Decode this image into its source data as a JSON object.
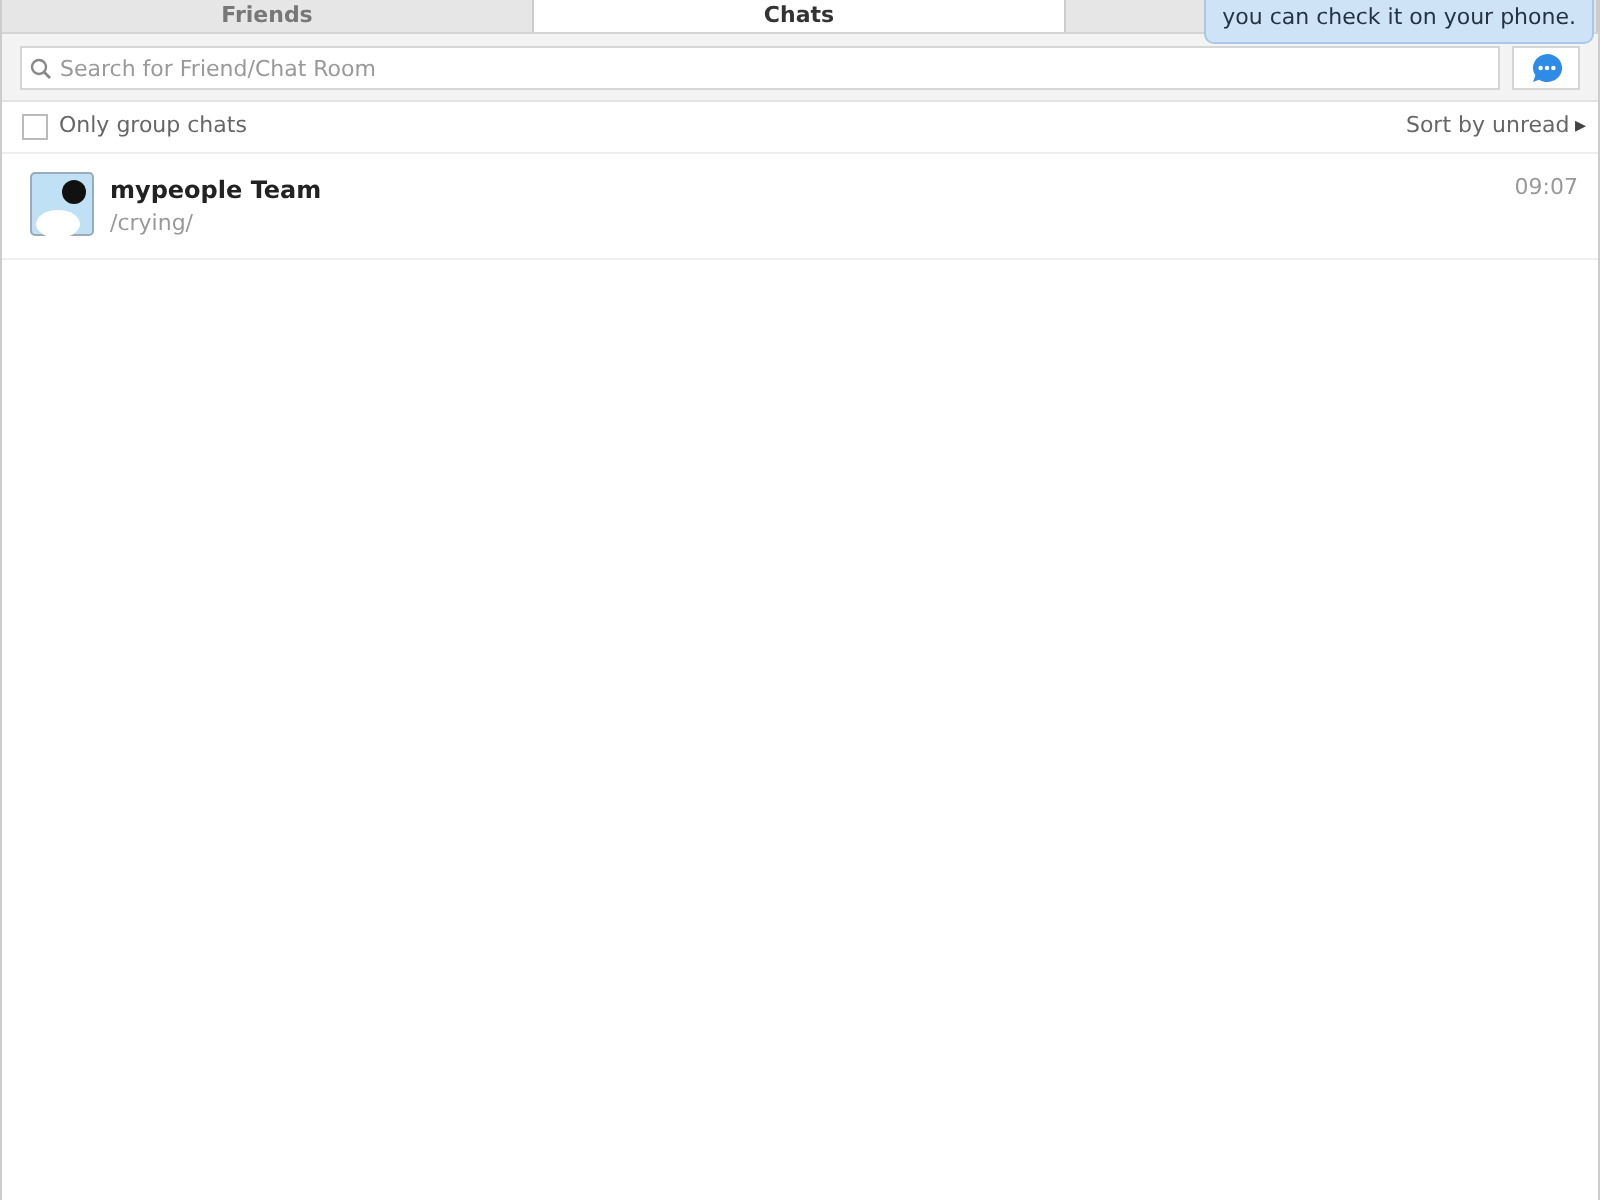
{
  "tabs": [
    {
      "label": "Friends",
      "selected": false
    },
    {
      "label": "Chats",
      "selected": true
    },
    {
      "selected": false
    }
  ],
  "tooltip": {
    "text": "you can check it on your phone."
  },
  "search": {
    "placeholder": "Search for Friend/Chat Room"
  },
  "filter": {
    "label": "Only group chats",
    "checked": false
  },
  "sort": {
    "label": "Sort by unread",
    "arrow": "▸"
  },
  "chats": [
    {
      "name": "mypeople Team",
      "message": "/crying/",
      "time": "09:07"
    }
  ]
}
